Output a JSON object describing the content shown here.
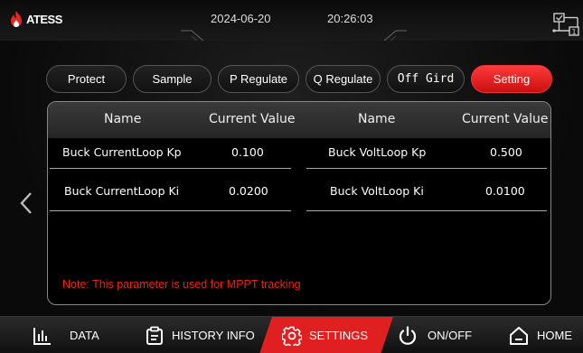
{
  "header": {
    "brand": "ATESS",
    "date": "2024-06-20",
    "time": "20:26:03"
  },
  "tabs": [
    {
      "label": "Protect",
      "active": false
    },
    {
      "label": "Sample",
      "active": false
    },
    {
      "label": "P Regulate",
      "active": false
    },
    {
      "label": "Q Regulate",
      "active": false
    },
    {
      "label": "Off Gird",
      "active": false
    },
    {
      "label": "Setting",
      "active": true
    }
  ],
  "table": {
    "headers": [
      "Name",
      "Current Value",
      "Name",
      "Current Value"
    ],
    "rows": [
      [
        "Buck CurrentLoop Kp",
        "0.100",
        "Buck VoltLoop Kp",
        "0.500"
      ],
      [
        "Buck CurrentLoop Ki",
        "0.0200",
        "Buck VoltLoop Ki",
        "0.0100"
      ]
    ]
  },
  "note": "Note: This parameter is used for MPPT tracking",
  "bottom_nav": [
    {
      "label": "DATA",
      "icon": "bar-chart-icon"
    },
    {
      "label": "HISTORY INFO",
      "icon": "clipboard-icon"
    },
    {
      "label": "SETTINGS",
      "icon": "gear-icon",
      "active": true
    },
    {
      "label": "ON/OFF",
      "icon": "power-icon"
    },
    {
      "label": "HOME",
      "icon": "home-icon"
    }
  ],
  "colors": {
    "accent": "#e02020",
    "note": "#ee2211"
  }
}
